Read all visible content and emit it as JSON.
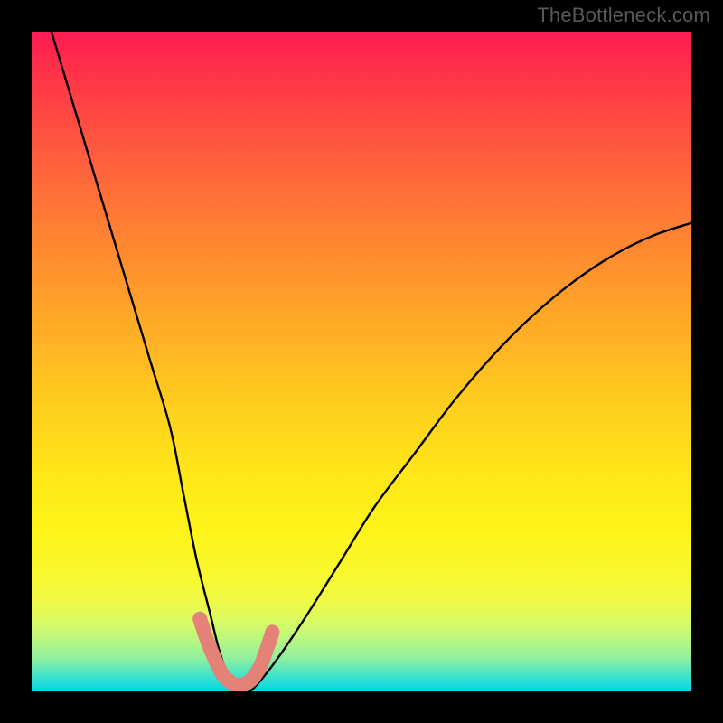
{
  "watermark_text": "TheBottleneck.com",
  "chart_data": {
    "type": "line",
    "title": "",
    "xlabel": "",
    "ylabel": "",
    "xlim": [
      0,
      100
    ],
    "ylim": [
      0,
      100
    ],
    "background_gradient_meaning": "red (top) = high bottleneck, green (bottom) = low bottleneck",
    "series": [
      {
        "name": "bottleneck-curve",
        "x": [
          3,
          6,
          9,
          12,
          15,
          18,
          21,
          23,
          25,
          27,
          28.5,
          30,
          31.5,
          33,
          35,
          38,
          42,
          47,
          52,
          58,
          64,
          70,
          76,
          82,
          88,
          94,
          100
        ],
        "values": [
          100,
          90,
          80,
          70,
          60,
          50,
          40,
          30,
          20,
          12,
          6,
          2,
          0,
          0,
          2,
          6,
          12,
          20,
          28,
          36,
          44,
          51,
          57,
          62,
          66,
          69,
          71
        ]
      },
      {
        "name": "salmon-marker-band",
        "note": "short pink segment near the curve minimum",
        "x": [
          25.5,
          26.5,
          27.5,
          29,
          31,
          33,
          34.5,
          35.5,
          36.5
        ],
        "values": [
          11,
          8,
          5.5,
          2.5,
          1,
          1.5,
          3.5,
          6,
          9
        ]
      }
    ],
    "minimum_at_x": 32
  }
}
